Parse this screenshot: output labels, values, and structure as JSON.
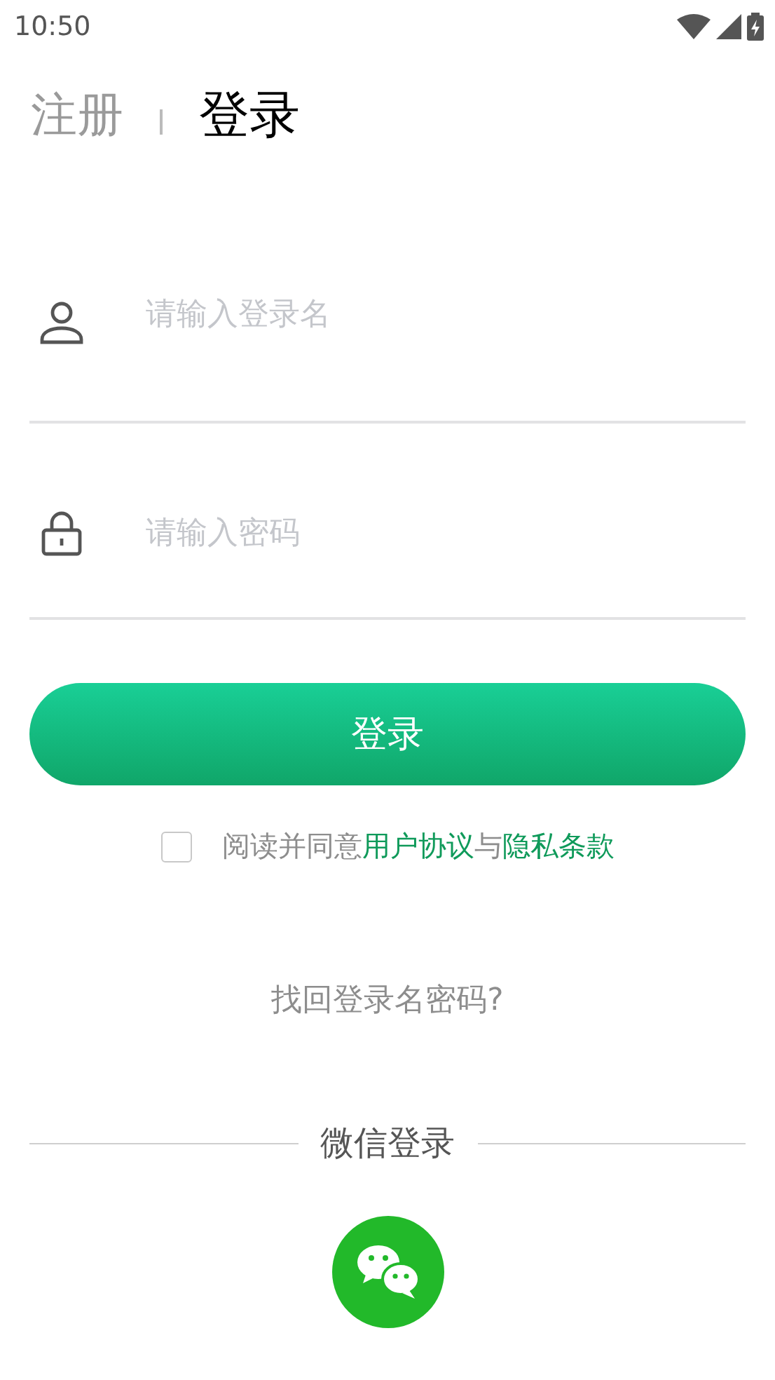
{
  "status_bar": {
    "time": "10:50"
  },
  "tabs": [
    {
      "label": "注册",
      "selected": false
    },
    {
      "label": "登录",
      "selected": true
    }
  ],
  "fields": [
    {
      "kind": "user",
      "placeholder": "请输入登录名"
    },
    {
      "kind": "lock",
      "placeholder": "请输入密码"
    }
  ],
  "login_button": {
    "label": "登录"
  },
  "agreement": {
    "checked": false,
    "parts": [
      {
        "kind": "text",
        "text": "阅读并同意"
      },
      {
        "kind": "link",
        "text": "用户协议"
      },
      {
        "kind": "text",
        "text": "与"
      },
      {
        "kind": "link",
        "text": "隐私条款"
      }
    ]
  },
  "forgot_link": "找回登录名密码?",
  "third_party": {
    "title": "微信登录"
  }
}
